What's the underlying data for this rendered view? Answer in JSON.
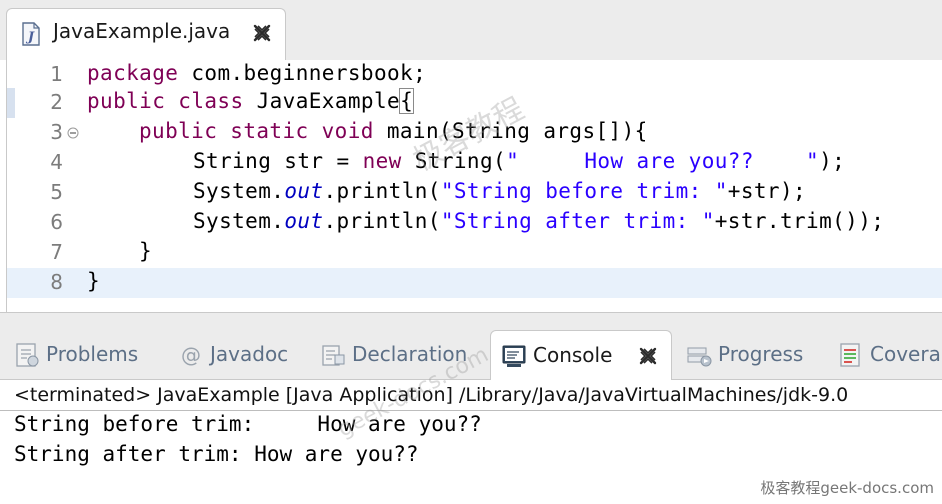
{
  "editor": {
    "tab_label": "JavaExample.java",
    "lines": [
      {
        "num": "1"
      },
      {
        "num": "2"
      },
      {
        "num": "3"
      },
      {
        "num": "4"
      },
      {
        "num": "5"
      },
      {
        "num": "6"
      },
      {
        "num": "7"
      },
      {
        "num": "8"
      }
    ],
    "code": {
      "l1_kw": "package",
      "l1_rest": " com.beginnersbook;",
      "l2_kw": "public class",
      "l2_rest": " JavaExample",
      "l2_brace": "{",
      "l3_kw": "public static void",
      "l3_rest": " main(String args[]){",
      "l4_pre": "String str = ",
      "l4_kw": "new",
      "l4_mid": " String(",
      "l4_str": "\"     How are you??    \"",
      "l4_end": ");",
      "l5_pre": "System.",
      "l5_fld": "out",
      "l5_mid": ".println(",
      "l5_str": "\"String before trim: \"",
      "l5_end": "+str);",
      "l6_pre": "System.",
      "l6_fld": "out",
      "l6_mid": ".println(",
      "l6_str": "\"String after trim: \"",
      "l6_end": "+str.trim());",
      "l7": "}",
      "l8": "}"
    }
  },
  "panel": {
    "tabs": [
      {
        "label": "Problems"
      },
      {
        "label": "Javadoc"
      },
      {
        "label": "Declaration"
      },
      {
        "label": "Console"
      },
      {
        "label": "Progress"
      },
      {
        "label": "Covera"
      }
    ],
    "console_status": "<terminated> JavaExample [Java Application] /Library/Java/JavaVirtualMachines/jdk-9.0",
    "output": [
      "String before trim:     How are you??",
      "String after trim: How are you??"
    ]
  },
  "watermark": {
    "corner": "极客教程geek-docs.com",
    "diag_cn": "极客教程",
    "diag_en": "geek-docs.com"
  },
  "colors": {
    "keyword": "#7f0055",
    "string": "#2a00ff",
    "field": "#0000c0",
    "current_line": "#e8f1fb"
  }
}
